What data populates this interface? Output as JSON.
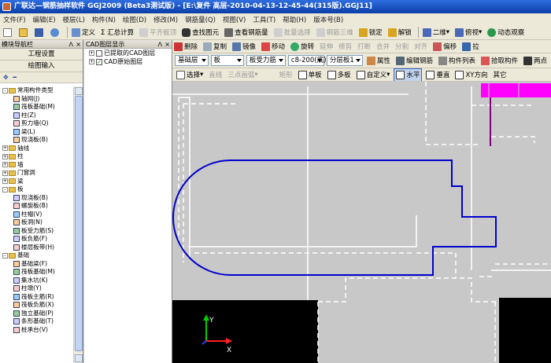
{
  "title": "广联达—钢筋抽样软件 GGJ2009 (Beta3测试版) - [E:\\复件 高层-2010-04-13-12-45-44(315版).GGJ11]",
  "menu": [
    "文件(F)",
    "编辑(E)",
    "楼层(L)",
    "构件(N)",
    "绘图(D)",
    "修改(M)",
    "钢筋量(Q)",
    "视图(V)",
    "工具(T)",
    "帮助(H)",
    "版本号(B)"
  ],
  "toolbar1": {
    "define": "定义",
    "sum": "Σ 汇总计算",
    "flat_board": "平齐板顶",
    "find": "查找图元",
    "view_rebar": "查看钢筋量",
    "batch_select": "批量选择",
    "rebar_3d": "钢筋三维",
    "lock": "锁定",
    "unlock": "解锁",
    "view_2d": "二维",
    "view_top": "俯视",
    "dynamic": "动态观察"
  },
  "left_panel": {
    "header": "模块导航栏",
    "btn_settings": "工程设置",
    "btn_draw": "绘图输入",
    "tree": [
      {
        "level": 0,
        "type": "folder",
        "exp": "-",
        "label": "常用构件类型"
      },
      {
        "level": 1,
        "type": "item",
        "label": "轴网(J)"
      },
      {
        "level": 1,
        "type": "item",
        "label": "筏板基础(M)"
      },
      {
        "level": 1,
        "type": "item",
        "label": "柱(Z)"
      },
      {
        "level": 1,
        "type": "item",
        "label": "剪力墙(Q)"
      },
      {
        "level": 1,
        "type": "item",
        "label": "梁(L)"
      },
      {
        "level": 1,
        "type": "item",
        "label": "现浇板(B)"
      },
      {
        "level": 0,
        "type": "folder",
        "exp": "+",
        "label": "轴线"
      },
      {
        "level": 0,
        "type": "folder",
        "exp": "+",
        "label": "柱"
      },
      {
        "level": 0,
        "type": "folder",
        "exp": "+",
        "label": "墙"
      },
      {
        "level": 0,
        "type": "folder",
        "exp": "+",
        "label": "门窗洞"
      },
      {
        "level": 0,
        "type": "folder",
        "exp": "+",
        "label": "梁"
      },
      {
        "level": 0,
        "type": "folder",
        "exp": "-",
        "label": "板"
      },
      {
        "level": 1,
        "type": "item",
        "label": "现浇板(B)"
      },
      {
        "level": 1,
        "type": "item",
        "label": "螺旋板(B)"
      },
      {
        "level": 1,
        "type": "item",
        "label": "柱帽(V)"
      },
      {
        "level": 1,
        "type": "item",
        "label": "板洞(N)"
      },
      {
        "level": 1,
        "type": "item",
        "label": "板受力筋(S)"
      },
      {
        "level": 1,
        "type": "item",
        "label": "板负筋(F)"
      },
      {
        "level": 1,
        "type": "item",
        "label": "楼层板带(H)"
      },
      {
        "level": 0,
        "type": "folder",
        "exp": "-",
        "label": "基础"
      },
      {
        "level": 1,
        "type": "item",
        "label": "基础梁(F)"
      },
      {
        "level": 1,
        "type": "item",
        "label": "筏板基础(M)"
      },
      {
        "level": 1,
        "type": "item",
        "label": "集水坑(K)"
      },
      {
        "level": 1,
        "type": "item",
        "label": "柱墩(Y)"
      },
      {
        "level": 1,
        "type": "item",
        "label": "筏板主筋(R)"
      },
      {
        "level": 1,
        "type": "item",
        "label": "筏板负筋(X)"
      },
      {
        "level": 1,
        "type": "item",
        "label": "独立基础(P)"
      },
      {
        "level": 1,
        "type": "item",
        "label": "条形基础(T)"
      },
      {
        "level": 1,
        "type": "item",
        "label": "桩承台(V)"
      }
    ]
  },
  "cad_panel": {
    "header": "CAD图层显示",
    "rows": [
      {
        "label": "已提取的CAD图层",
        "checked": false
      },
      {
        "label": "CAD原始图层",
        "checked": true
      }
    ]
  },
  "rtb1": {
    "delete": "删除",
    "copy": "复制",
    "mirror": "镜像",
    "move": "移动",
    "rotate": "旋转",
    "extend": "延伸",
    "trim": "修剪",
    "break": "打断",
    "merge": "合并",
    "split": "分割",
    "align": "对齐",
    "offset": "偏移",
    "pull": "拉"
  },
  "rtb2": {
    "layer": "基础层",
    "component_type": "板",
    "sub_type": "板受力筋",
    "spec": "c8-200(底)",
    "floor_layer": "分层板1",
    "props": "属性",
    "edit_rebar": "编辑钢筋",
    "comp_list": "构件列表",
    "pick": "拾取构件",
    "two_point": "两点"
  },
  "rtb3": {
    "select": "选择",
    "line": "直线",
    "three_arc": "三点画弧",
    "rect": "矩形",
    "single": "单板",
    "multi": "多板",
    "custom": "自定义",
    "horizontal": "水平",
    "vertical": "垂直",
    "xy": "XY方向",
    "other": "其它"
  },
  "colors": {
    "selection": "#0000cc",
    "magenta": "#ff00ff",
    "canvas": "#c8c8c8",
    "black": "#000000"
  }
}
